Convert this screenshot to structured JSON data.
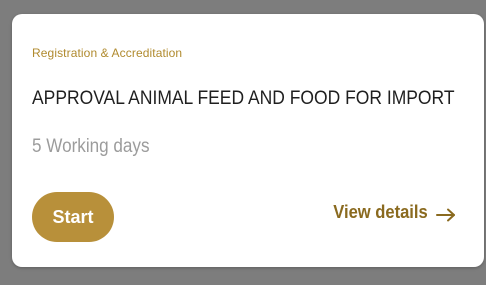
{
  "card": {
    "category": "Registration & Accreditation",
    "title": "APPROVAL ANIMAL FEED AND FOOD FOR IMPORT",
    "duration": "5 Working days",
    "start_label": "Start",
    "view_details_label": "View details",
    "arrow_icon": "arrow-right-icon"
  },
  "colors": {
    "accent": "#b8903a",
    "link": "#8a6a1f",
    "category": "#b08a2e",
    "background": "#7d7d7d",
    "card": "#ffffff",
    "title": "#1f1f1f",
    "muted": "#9c9c9c"
  }
}
